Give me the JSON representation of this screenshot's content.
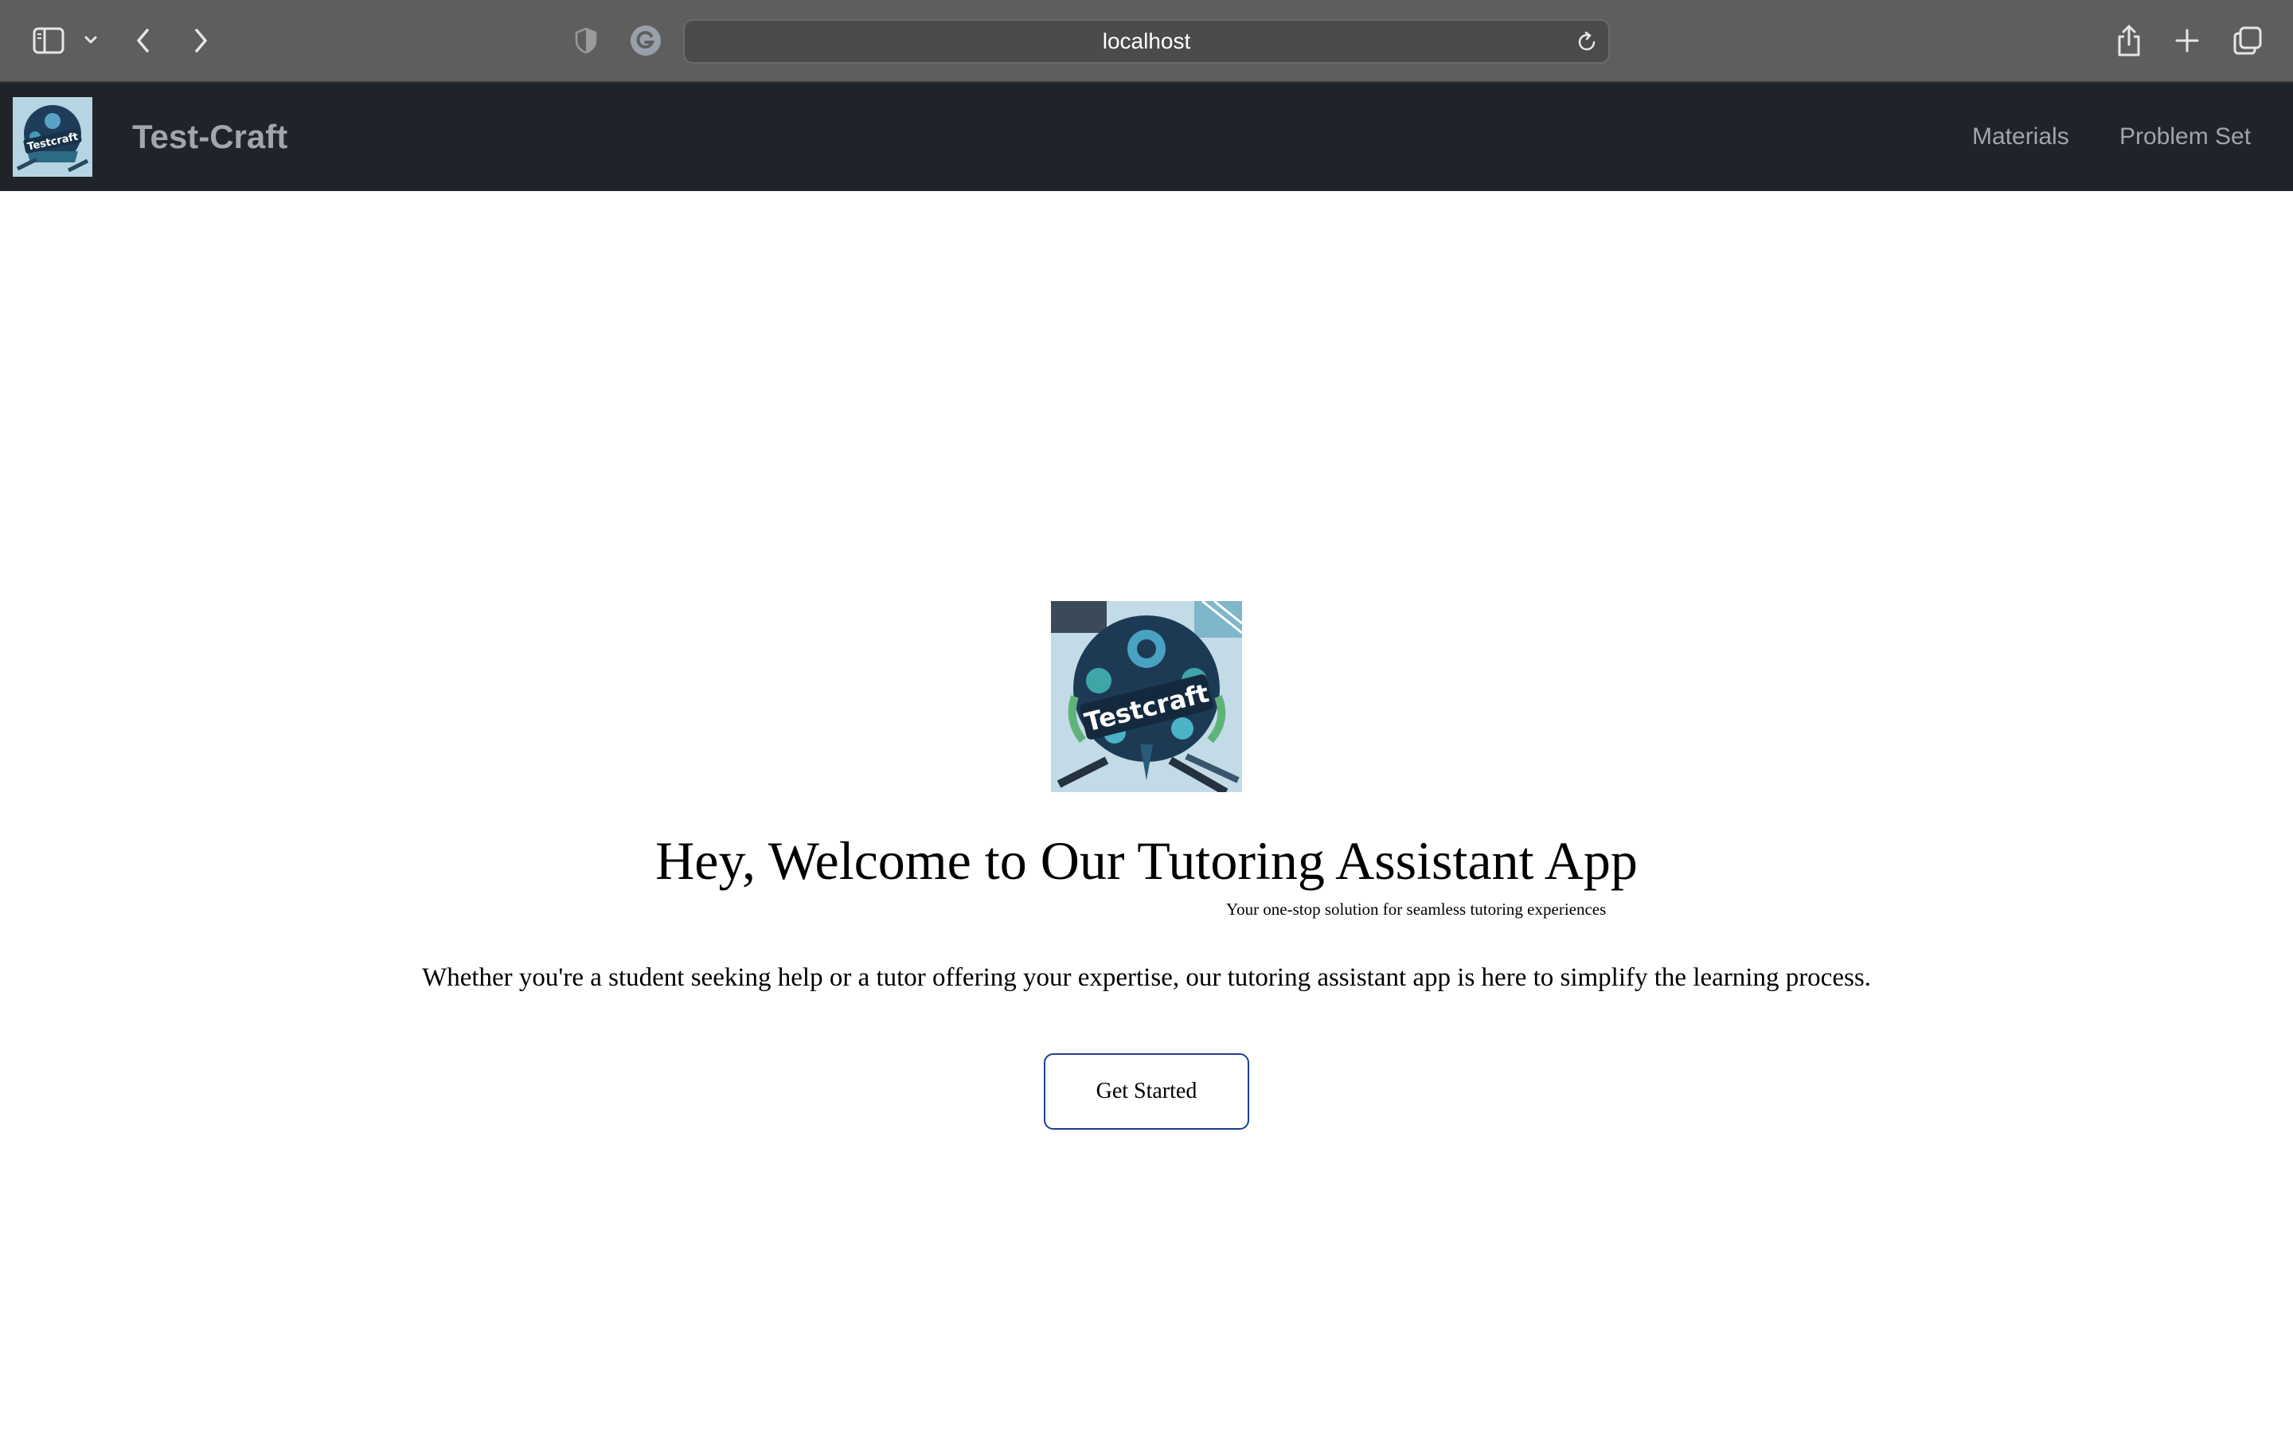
{
  "browser": {
    "url": "localhost",
    "icons": {
      "sidebar": "sidebar-icon",
      "sidebar_menu": "chevron-down-icon",
      "back": "chevron-left-icon",
      "forward": "chevron-right-icon",
      "privacy": "shield-icon",
      "extension": "grammarly-icon",
      "reload": "reload-icon",
      "share": "share-icon",
      "new_tab": "plus-icon",
      "tabs": "tabs-overview-icon"
    }
  },
  "navbar": {
    "brand": "Test-Craft",
    "logo_text": "Testcraft",
    "links": [
      "Materials",
      "Problem Set"
    ]
  },
  "hero": {
    "logo_text": "Testcraft",
    "title": "Hey, Welcome to Our Tutoring Assistant App",
    "subtitle": "Your one-stop solution for seamless tutoring experiences",
    "body": "Whether you're a student seeking help or a tutor offering your expertise, our tutoring assistant app is here to simplify the learning process.",
    "cta_label": "Get Started"
  },
  "colors": {
    "browser_chrome": "#5e5e5e",
    "navbar_bg": "#1f232a",
    "nav_text": "#a2a5a9",
    "cta_border": "#1d3f91"
  }
}
